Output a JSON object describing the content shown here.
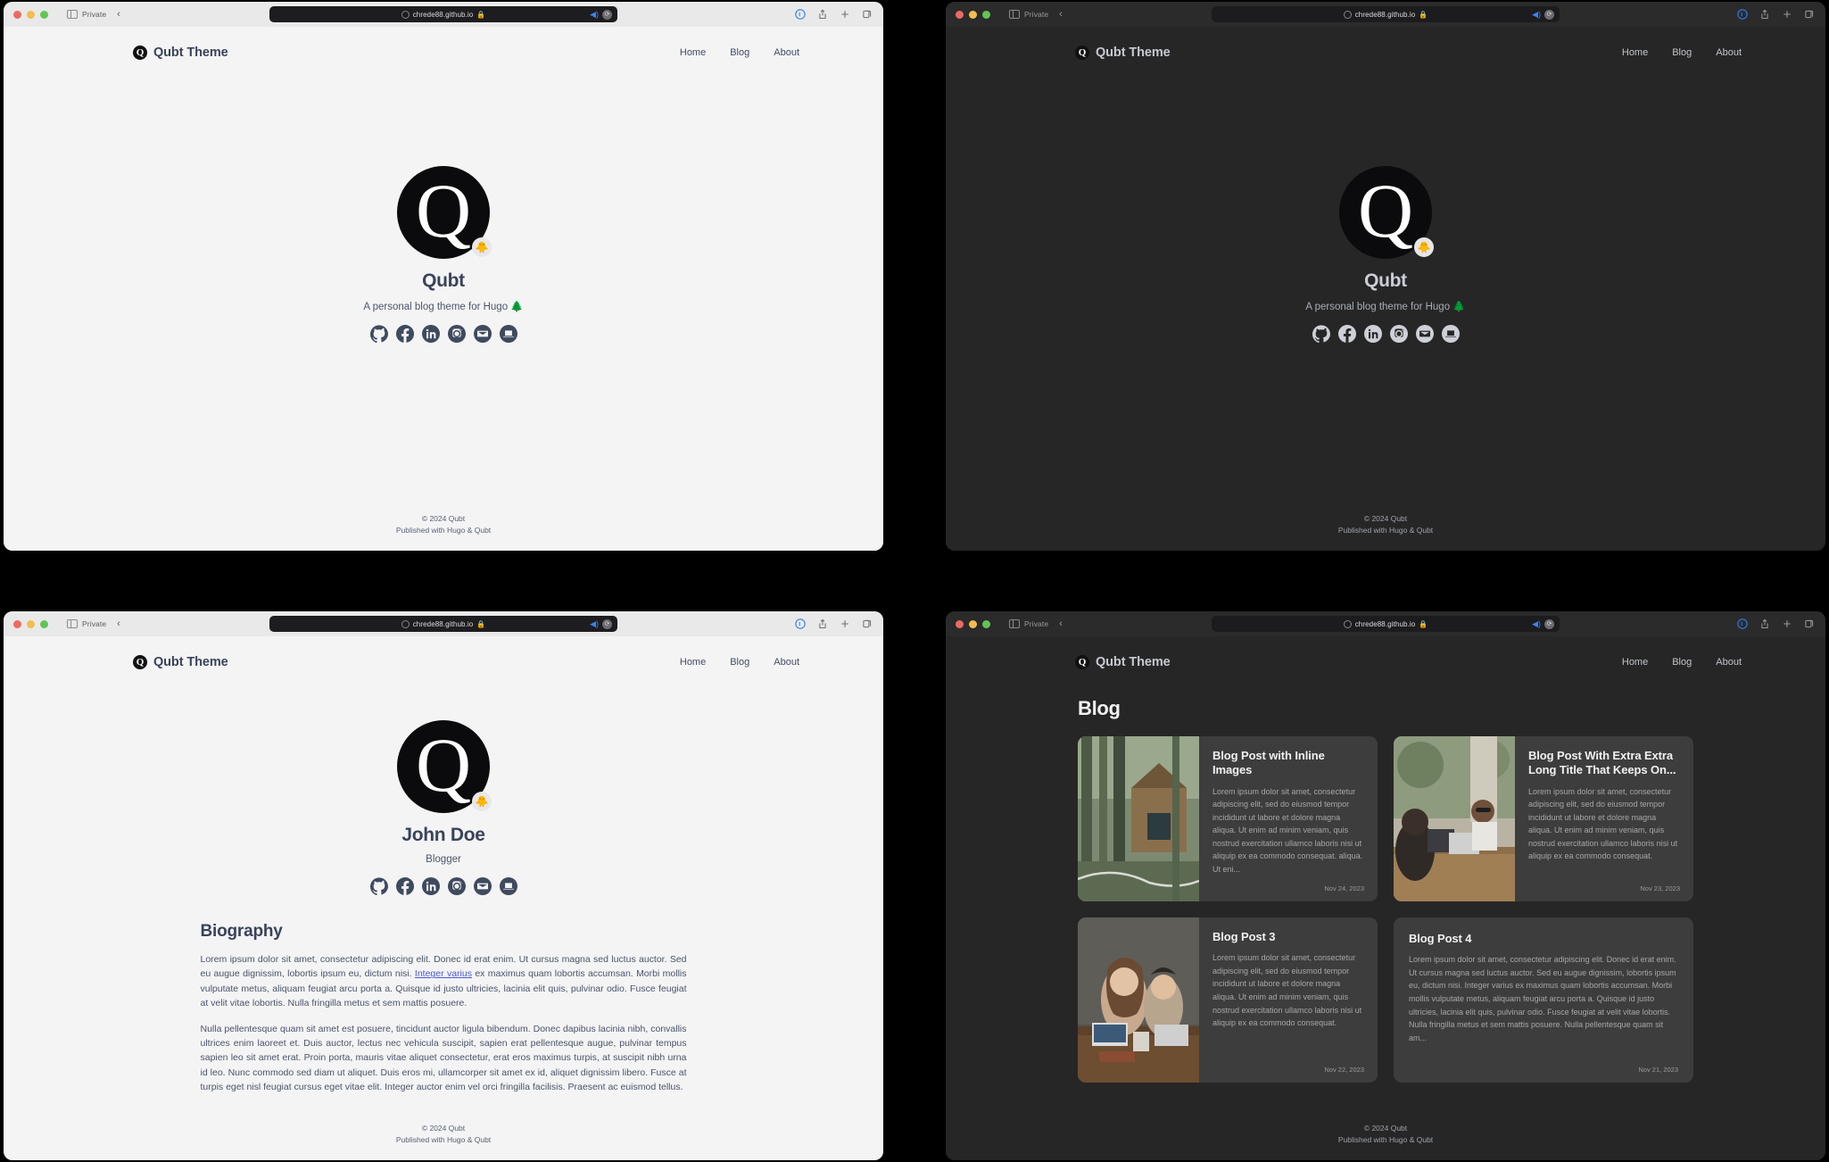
{
  "browser": {
    "private_label": "Private",
    "back_chevron": "‹",
    "url": "chrede88.github.io",
    "lock_icon": "lock-icon",
    "shield_icon": "privacy-shield-icon",
    "speaker_icon": "audio-icon",
    "reload_icon": "reload-icon",
    "actions": [
      "reader-icon",
      "share-icon",
      "new-tab-icon",
      "tab-overview-icon"
    ],
    "traffic_lights": [
      "close-button",
      "minimize-button",
      "zoom-button"
    ]
  },
  "site": {
    "brand_mark": "Q",
    "brand_name": "Qubt Theme",
    "nav": [
      {
        "label": "Home"
      },
      {
        "label": "Blog"
      },
      {
        "label": "About"
      }
    ],
    "footer": {
      "copyright": "© 2024 Qubt",
      "published": "Published with Hugo & Qubt"
    },
    "socials": [
      {
        "name": "github-icon"
      },
      {
        "name": "facebook-icon"
      },
      {
        "name": "linkedin-icon"
      },
      {
        "name": "instagram-icon"
      },
      {
        "name": "email-icon"
      },
      {
        "name": "laptop-icon"
      }
    ]
  },
  "home": {
    "avatar_letter": "Q",
    "badge_emoji": "🐥",
    "title": "Qubt",
    "subtitle": "A personal blog theme for Hugo 🌲"
  },
  "about": {
    "avatar_letter": "Q",
    "badge_emoji": "🐥",
    "name": "John Doe",
    "role": "Blogger",
    "heading": "Biography",
    "p1_before": "Lorem ipsum dolor sit amet, consectetur adipiscing elit. Donec id erat enim. Ut cursus magna sed luctus auctor. Sed eu augue dignissim, lobortis ipsum eu, dictum nisi. ",
    "p1_link": "Integer varius",
    "p1_after": " ex maximus quam lobortis accumsan. Morbi mollis vulputate metus, aliquam feugiat arcu porta a. Quisque id justo ultricies, lacinia elit quis, pulvinar odio. Fusce feugiat at velit vitae lobortis. Nulla fringilla metus et sem mattis posuere.",
    "p2": "Nulla pellentesque quam sit amet est posuere, tincidunt auctor ligula bibendum. Donec dapibus lacinia nibh, convallis ultrices enim laoreet et. Duis auctor, lectus nec vehicula suscipit, sapien erat pellentesque augue, pulvinar tempus sapien leo sit amet erat. Proin porta, mauris vitae aliquet consectetur, erat eros maximus turpis, at suscipit nibh urna id leo. Nunc commodo sed diam ut aliquet. Duis eros mi, ullamcorper sit amet ex id, aliquet dignissim libero. Fusce at turpis eget nisl feugiat cursus eget vitae elit. Integer auctor enim vel orci fringilla facilisis. Praesent ac euismod tellus."
  },
  "blog": {
    "heading": "Blog",
    "posts": [
      {
        "title": "Blog Post with Inline Images",
        "excerpt": "Lorem ipsum dolor sit amet, consectetur adipiscing elit, sed do eiusmod tempor incididunt ut labore et dolore magna aliqua. Ut enim ad minim veniam, quis nostrud exercitation ullamco laboris nisi ut aliquip ex ea commodo consequat. aliqua. Ut eni...",
        "date": "Nov 24, 2023",
        "thumb": "cabin-in-forest"
      },
      {
        "title": "Blog Post With Extra Extra Long Title That Keeps On...",
        "excerpt": "Lorem ipsum dolor sit amet, consectetur adipiscing elit, sed do eiusmod tempor incididunt ut labore et dolore magna aliqua. Ut enim ad minim veniam, quis nostrud exercitation ullamco laboris nisi ut aliquip ex ea commodo consequat.",
        "date": "Nov 23, 2023",
        "thumb": "people-at-outdoor-table"
      },
      {
        "title": "Blog Post 3",
        "excerpt": "Lorem ipsum dolor sit amet, consectetur adipiscing elit, sed do eiusmod tempor incididunt ut labore et dolore magna aliqua. Ut enim ad minim veniam, quis nostrud exercitation ullamco laboris nisi ut aliquip ex ea commodo consequat.",
        "date": "Nov 22, 2023",
        "thumb": "people-with-laptops"
      },
      {
        "title": "Blog Post 4",
        "excerpt": "Lorem ipsum dolor sit amet, consectetur adipiscing elit. Donec id erat enim. Ut cursus magna sed luctus auctor. Sed eu augue dignissim, lobortis ipsum eu, dictum nisi. Integer varius ex maximus quam lobortis accumsan. Morbi mollis vulputate metus, aliquam feugiat arcu porta a. Quisque id justo ultricies, lacinia elit quis, pulvinar odio. Fusce feugiat at velit vitae lobortis. Nulla fringilla metus et sem mattis posuere. Nulla pellentesque quam sit am...",
        "date": "Nov 21, 2023",
        "thumb": null
      }
    ]
  },
  "colors": {
    "light_bg": "#f4f4f5",
    "dark_bg": "#262626",
    "card_bg": "#3d3d3d",
    "text_light": "#3f4a5f",
    "text_dark": "#c9cbd1",
    "link": "#4a5bd4"
  }
}
